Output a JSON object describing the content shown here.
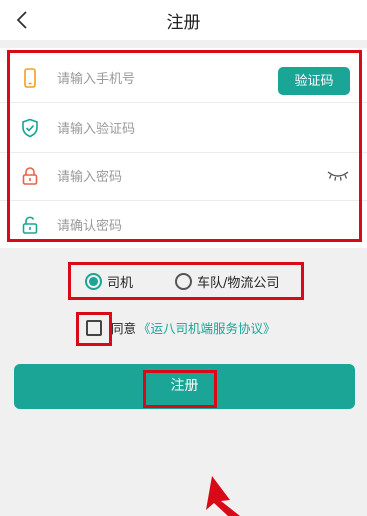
{
  "header": {
    "title": "注册",
    "back_icon": "chevron-left-icon"
  },
  "form": {
    "phone_placeholder": "请输入手机号",
    "code_button": "验证码",
    "code_placeholder": "请输入验证码",
    "password_placeholder": "请输入密码",
    "confirm_placeholder": "请确认密码"
  },
  "role": {
    "options": [
      "司机",
      "车队/物流公司"
    ],
    "selected": "司机"
  },
  "agreement": {
    "checked": false,
    "prefix": "同意",
    "link": "《运八司机端服务协议》"
  },
  "submit_label": "注册",
  "colors": {
    "accent": "#1aa596",
    "annotation": "#d90a18"
  }
}
